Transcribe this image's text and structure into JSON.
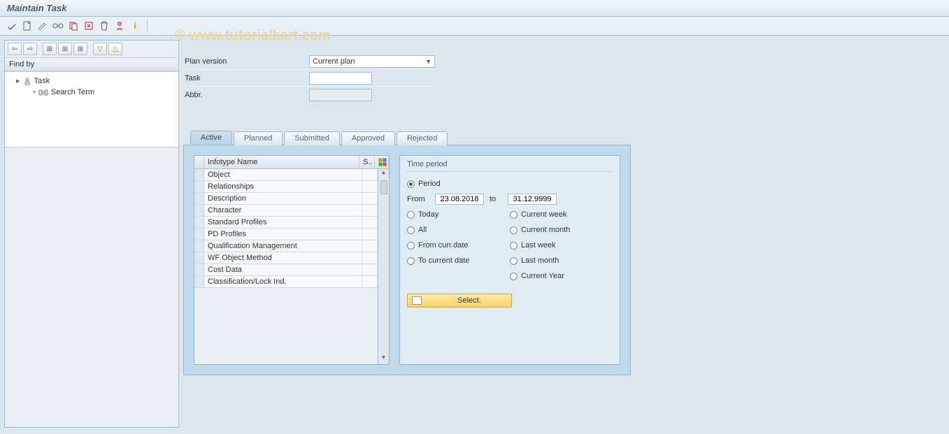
{
  "title": "Maintain Task",
  "watermark": "©  www.tutorialkart.com",
  "sidebar": {
    "findby_label": "Find by",
    "tree": {
      "root": "Task",
      "child": "Search Term"
    }
  },
  "form": {
    "plan_version_label": "Plan version",
    "plan_version_value": "Current plan",
    "task_label": "Task",
    "task_value": "",
    "abbr_label": "Abbr.",
    "abbr_value": ""
  },
  "tabs": [
    "Active",
    "Planned",
    "Submitted",
    "Approved",
    "Rejected"
  ],
  "table": {
    "header_name": "Infotype Name",
    "header_s": "S..",
    "rows": [
      "Object",
      "Relationships",
      "Description",
      "Character",
      "Standard Profiles",
      "PD Profiles",
      "Qualification Management",
      "WF Object Method",
      "Cost Data",
      "Classification/Lock Ind."
    ]
  },
  "period": {
    "title": "Time period",
    "period_label": "Period",
    "from_label": "From",
    "from_value": "23.08.2018",
    "to_label": "to",
    "to_value": "31.12.9999",
    "opts_left": [
      "Today",
      "All",
      "From curr.date",
      "To current date"
    ],
    "opts_right": [
      "Current week",
      "Current month",
      "Last week",
      "Last month",
      "Current Year"
    ],
    "select_label": "Select."
  }
}
